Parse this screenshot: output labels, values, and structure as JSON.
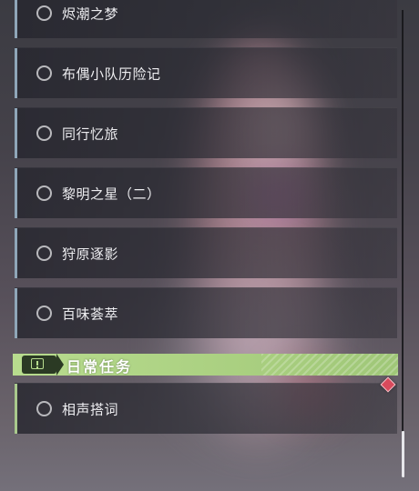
{
  "quests": [
    {
      "label": "烬潮之梦",
      "type": "main"
    },
    {
      "label": "布偶小队历险记",
      "type": "main"
    },
    {
      "label": "同行忆旅",
      "type": "main"
    },
    {
      "label": "黎明之星（二）",
      "type": "main"
    },
    {
      "label": "狩原逐影",
      "type": "main"
    },
    {
      "label": "百味荟萃",
      "type": "main"
    }
  ],
  "daily_section": {
    "title": "日常任务",
    "icon": "notice-icon",
    "accent_color": "#b8dc8e"
  },
  "daily_quests": [
    {
      "label": "相声搭词",
      "type": "daily",
      "badge_icon": "new-diamond-icon"
    }
  ],
  "colors": {
    "main_accent": "#8fa6b8",
    "daily_accent": "#a9c98d",
    "badge": "#d94a5c"
  }
}
